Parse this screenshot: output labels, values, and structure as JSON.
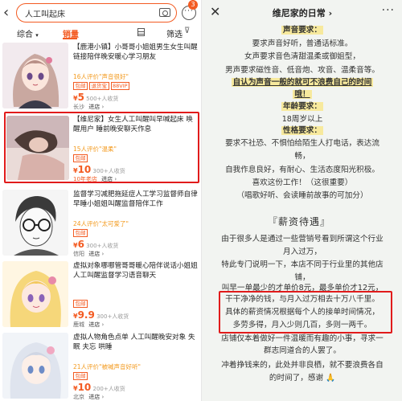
{
  "left": {
    "search": {
      "query": "人工叫起床",
      "badge": "3"
    },
    "tabs": {
      "comprehensive": "综合",
      "sales": "销量",
      "filter": "筛选"
    },
    "items": [
      {
        "title_tag": "【鹿港小镇】",
        "title": "小哥哥小姐姐男生女生叫醒链接陪伴晚安暖心学习朋友",
        "review": "16人评价\"声音很好\"",
        "chips": [
          "包邮",
          "退货宝",
          "88VIP"
        ],
        "price": "5",
        "buyers": "500+人收货",
        "location": "长沙",
        "store_link": "进店"
      },
      {
        "title_tag": "【维尼家】",
        "title": "女生人工叫醒叫早喊起床 唤醒用户 睡前晚安聊天作息",
        "review": "15人评价\"温柔\"",
        "chips": [
          "包邮"
        ],
        "price": "10",
        "buyers": "300+人收货",
        "location": "10年老店",
        "store_link": "进店"
      },
      {
        "title_tag": "",
        "title": "监督学习减肥拖延症人工学习监督师自律早睡小姐姐叫醒监督陪伴工作",
        "review": "24人评价\"太可爱了\"",
        "chips": [
          "包邮"
        ],
        "price": "6",
        "buyers": "300+人收货",
        "location": "信阳",
        "store_link": "进店"
      },
      {
        "title_tag": "",
        "title": "虚拟对象哪哪管哥哥暖心陪伴说话小姐姐人工叫醒监督学习语音聊天",
        "review": "",
        "chips": [
          "包邮"
        ],
        "price": "9.9",
        "buyers": "300+人收货",
        "location": "鹿城",
        "store_link": "进店"
      },
      {
        "title_tag": "",
        "title": "虚拟人物角色点单 人工叫醒晚安对象 失眠 夫忘 哄睡",
        "review": "21人评价\"被喊声音好听\"",
        "chips": [
          "包邮"
        ],
        "price": "10",
        "buyers": "200+人收货",
        "location": "北京",
        "store_link": "进店"
      }
    ]
  },
  "right": {
    "header": {
      "title": "维尼家的日常"
    },
    "lines": {
      "l1": "声音要求：",
      "l2": "要求声音好听，普通话标准。",
      "l3": "女声要求音色清甜温柔或御姐型，",
      "l4": "男声要求磁性音、低音炮、攻音、温柔音等。",
      "l5": "自认为声音一般的就可不浪费自己的时间",
      "l6": "哦！",
      "l7": "年龄要求：",
      "l8": "18周岁以上",
      "l9": "性格要求：",
      "l10": "要求不社恐、不惧怕给陌生人打电话，表达流",
      "l11": "畅，",
      "l12": "自我作息良好，有耐心、生活态度阳光积极。",
      "l13": "喜欢这份工作！（这很重要）",
      "l14": "（唱歌好听、会读睡前故事的可加分）",
      "section": "『薪资待遇』",
      "l15": "由于很多人是通过一些营销号看到所谓这个行业",
      "l16": "月入过万，",
      "l17": "特此专门说明一下，本店不同于行业里的其他店",
      "l18": "铺，",
      "l19": "叫早一单最少的才单价8元，最多单价才12元，",
      "l20": "干干净净的钱，与月入过万相去十万八千里。",
      "l21": "具体的薪资情况根据每个人的接单时间情况，",
      "l22": "多劳多得，月入少则几百，多则一两千。",
      "l23": "店铺仅本着做好一件温暖而有趣的小事，寻求一",
      "l24": "群志同道合的人罢了。",
      "l25": "冲着挣钱来的，此处并非良栖，就不要浪费各自",
      "l26": "的时间了，感谢 🙏"
    }
  },
  "colors": {
    "accent": "#f35b22",
    "highlight_box": "#e11b1b",
    "marker": "#f7e99d",
    "review": "#f39a1e"
  }
}
